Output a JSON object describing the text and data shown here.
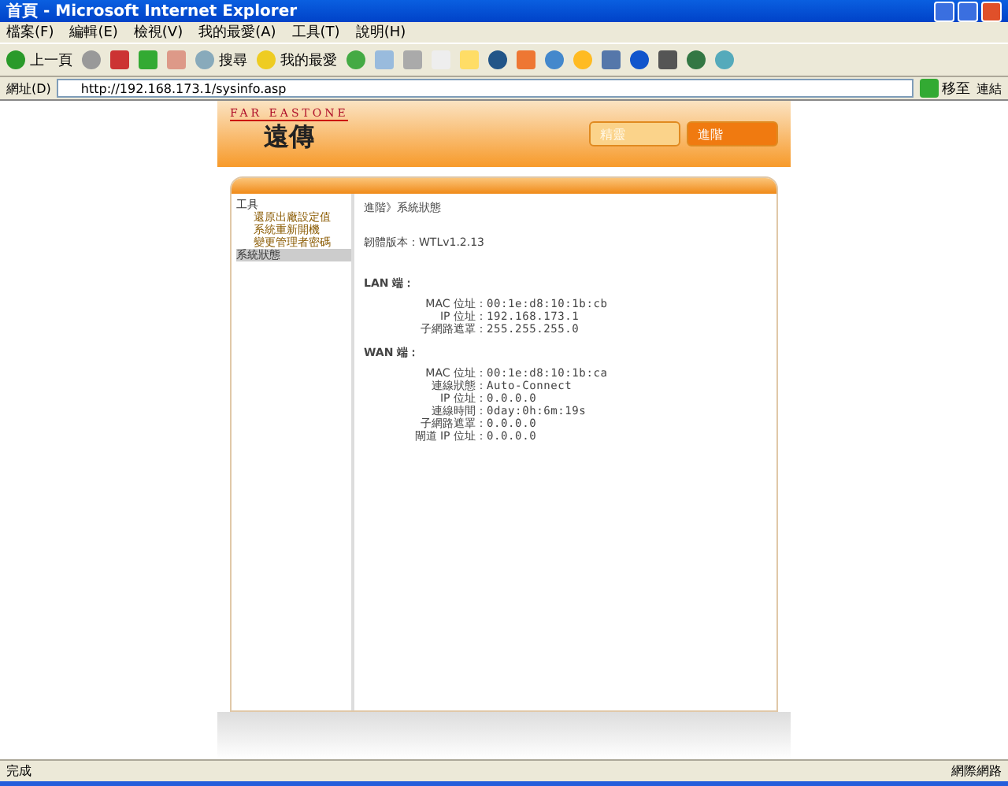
{
  "window": {
    "title": "首頁 - Microsoft Internet Explorer"
  },
  "menu": [
    "檔案(F)",
    "編輯(E)",
    "檢視(V)",
    "我的最愛(A)",
    "工具(T)",
    "說明(H)"
  ],
  "toolbar": {
    "back": "上一頁",
    "search": "搜尋",
    "favorites": "我的最愛"
  },
  "address": {
    "label": "網址(D)",
    "value": "http://192.168.173.1/sysinfo.asp",
    "go": "移至",
    "links": "連結"
  },
  "page": {
    "brand": "FAR EASTONE",
    "brand_sub": "遠傳",
    "header_buttons": [
      {
        "label": "精靈",
        "selected": false
      },
      {
        "label": "進階",
        "selected": true
      }
    ],
    "sidebar": [
      {
        "label": "工具",
        "selected": false,
        "children": [
          {
            "label": "還原出廠設定值",
            "selected": false
          },
          {
            "label": "系統重新開機",
            "selected": false
          },
          {
            "label": "變更管理者密碼",
            "selected": false
          }
        ]
      },
      {
        "label": "系統狀態",
        "selected": true
      }
    ],
    "breadcrumb": "進階》系統狀態",
    "firmware": {
      "label": "韌體版本：",
      "value": "WTLv1.2.13"
    },
    "sections": [
      {
        "title": "LAN 端：",
        "rows": [
          {
            "label": "MAC 位址：",
            "value": "00:1e:d8:10:1b:cb"
          },
          {
            "label": "IP 位址：",
            "value": "192.168.173.1"
          },
          {
            "label": "子網路遮罩：",
            "value": "255.255.255.0"
          }
        ]
      },
      {
        "title": "WAN 端：",
        "rows": [
          {
            "label": "MAC 位址：",
            "value": "00:1e:d8:10:1b:ca"
          },
          {
            "label": "連線狀態：",
            "value": "Auto-Connect"
          },
          {
            "label": "IP 位址：",
            "value": "0.0.0.0"
          },
          {
            "label": "連線時間：",
            "value": "0day:0h:6m:19s"
          },
          {
            "label": "子網路遮罩：",
            "value": "0.0.0.0"
          },
          {
            "label": "閘道 IP 位址：",
            "value": "0.0.0.0"
          }
        ]
      }
    ]
  },
  "status_bar": {
    "text": "完成",
    "zone": "網際網路"
  }
}
